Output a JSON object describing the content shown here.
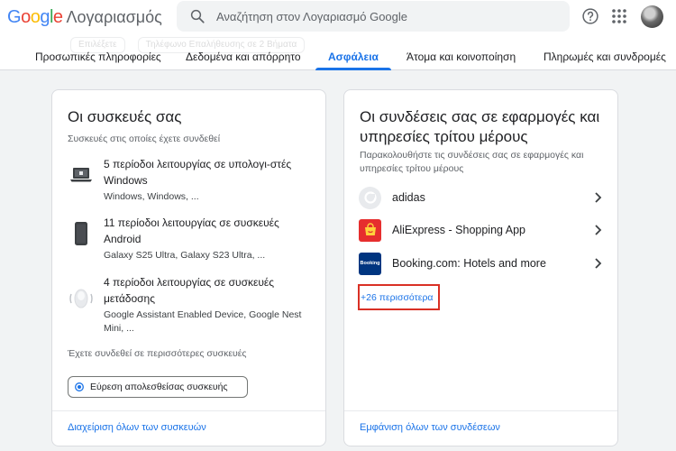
{
  "header": {
    "logo_google": "Google",
    "logo_product": "Λογαριασμός",
    "search_placeholder": "Αναζήτηση στον Λογαριασμό Google",
    "ghost_chips": [
      "Επιλέξετε",
      "Τηλέφωνο Επαλήθευσης σε 2 Βήματα"
    ]
  },
  "tabs": [
    {
      "label": "Προσωπικές πληροφορίες"
    },
    {
      "label": "Δεδομένα και απόρρητο"
    },
    {
      "label": "Ασφάλεια"
    },
    {
      "label": "Άτομα και κοινοποίηση"
    },
    {
      "label": "Πληρωμές και συνδρομές"
    }
  ],
  "devices_card": {
    "title": "Οι συσκευές σας",
    "subtitle": "Συσκευές στις οποίες έχετε συνδεθεί",
    "devices": [
      {
        "title": "5 περίοδοι λειτουργίας σε υπολογι-στές Windows",
        "detail": "Windows, Windows, ...",
        "icon": "laptop-icon"
      },
      {
        "title": "11 περίοδοι λειτουργίας σε συσκευές Android",
        "detail": "Galaxy S25 Ultra, Galaxy S23 Ultra, ...",
        "icon": "phone-icon"
      },
      {
        "title": "4 περίοδοι λειτουργίας σε συσκευές μετάδοσης",
        "detail": "Google Assistant Enabled Device, Google Nest Mini, ...",
        "icon": "speaker-icon"
      }
    ],
    "more_devices": "Έχετε συνδεθεί σε περισσότερες συσκευές",
    "find_device_button": "Εύρεση απολεσθείσας συσκευής",
    "manage_link": "Διαχείριση όλων των συσκευών"
  },
  "connections_card": {
    "title": "Οι συνδέσεις σας σε εφαρμογές και υπηρεσίες τρίτου μέρους",
    "subtitle": "Παρακολουθήστε τις συνδέσεις σας σε εφαρμογές και υπηρεσίες τρίτου μέρους",
    "apps": [
      {
        "name": "adidas",
        "icon": "adidas-icon"
      },
      {
        "name": "AliExpress - Shopping App",
        "icon": "aliexpress-icon"
      },
      {
        "name": "Booking.com: Hotels and more",
        "icon": "booking-icon",
        "icon_text": "Booking"
      }
    ],
    "more_apps": "+26 περισσότερα",
    "view_all_link": "Εμφάνιση όλων των συνδέσεων"
  },
  "colors": {
    "accent": "#1a73e8",
    "highlight_box": "#d93025",
    "background": "#f1f3f4"
  }
}
